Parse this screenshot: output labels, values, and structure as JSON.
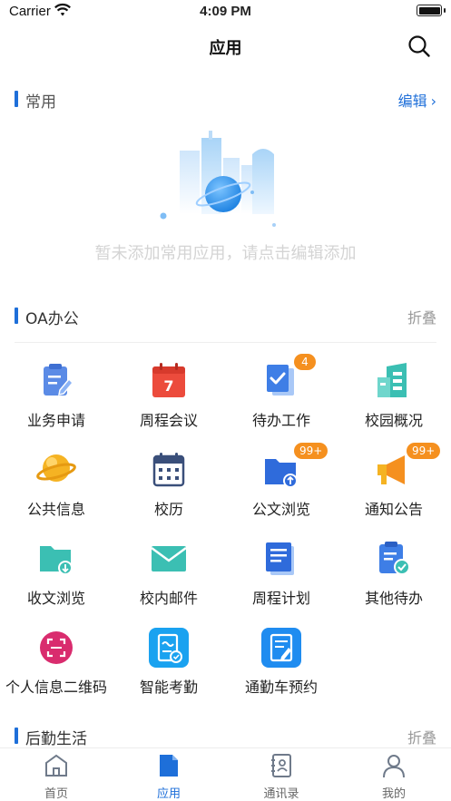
{
  "status_bar": {
    "carrier": "Carrier",
    "time": "4:09 PM"
  },
  "nav": {
    "title": "应用"
  },
  "favorites": {
    "title": "常用",
    "action": "编辑",
    "empty_text": "暂未添加常用应用，请点击编辑添加"
  },
  "oa": {
    "title": "OA办公",
    "action": "折叠",
    "items": [
      {
        "label": "业务申请",
        "icon": "clipboard-edit-icon"
      },
      {
        "label": "周程会议",
        "icon": "calendar-7-icon",
        "day": "7"
      },
      {
        "label": "待办工作",
        "icon": "todo-doc-icon",
        "badge": "4"
      },
      {
        "label": "校园概况",
        "icon": "buildings-icon"
      },
      {
        "label": "公共信息",
        "icon": "planet-icon"
      },
      {
        "label": "校历",
        "icon": "calendar-grid-icon"
      },
      {
        "label": "公文浏览",
        "icon": "folder-upload-icon",
        "badge": "99+"
      },
      {
        "label": "通知公告",
        "icon": "megaphone-icon",
        "badge": "99+"
      },
      {
        "label": "收文浏览",
        "icon": "folder-download-icon"
      },
      {
        "label": "校内邮件",
        "icon": "mail-icon"
      },
      {
        "label": "周程计划",
        "icon": "document-lines-icon"
      },
      {
        "label": "其他待办",
        "icon": "clipboard-check-icon"
      },
      {
        "label": "个人信息二维码",
        "icon": "scan-icon"
      },
      {
        "label": "智能考勤",
        "icon": "attendance-icon"
      },
      {
        "label": "通勤车预约",
        "icon": "bus-booking-icon"
      }
    ]
  },
  "logistics": {
    "title": "后勤生活",
    "action": "折叠"
  },
  "tabs": [
    {
      "label": "首页",
      "icon": "home-icon",
      "active": false
    },
    {
      "label": "应用",
      "icon": "app-doc-icon",
      "active": true
    },
    {
      "label": "通讯录",
      "icon": "contacts-icon",
      "active": false
    },
    {
      "label": "我的",
      "icon": "profile-icon",
      "active": false
    }
  ],
  "colors": {
    "accent": "#1e6fd9",
    "badge": "#f5901f",
    "teal": "#3bbfb3",
    "red": "#ec4b3c",
    "yellow": "#f5b323",
    "magenta": "#d92c6e",
    "cyan": "#1aa2f0"
  }
}
